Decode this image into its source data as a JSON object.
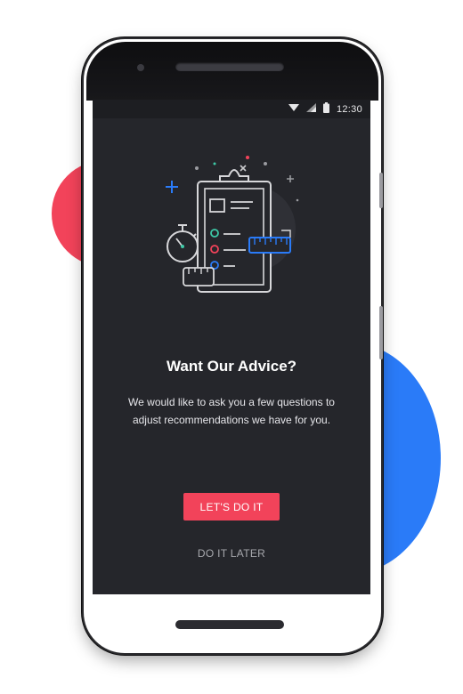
{
  "status_bar": {
    "time": "12:30",
    "icons": [
      "wifi-icon",
      "signal-icon",
      "battery-icon"
    ]
  },
  "onboarding": {
    "illustration": "clipboard-checklist-icon",
    "title": "Want Our Advice?",
    "description": "We would like to ask you a few questions to adjust recommendations we have for you.",
    "primary_button": "LET'S DO IT",
    "secondary_button": "DO IT LATER"
  },
  "colors": {
    "accent": "#f2435a",
    "secondary_accent": "#2a7bf8",
    "screen_background": "#25262b",
    "text_primary": "#ffffff",
    "text_muted": "#a7a8ad"
  }
}
